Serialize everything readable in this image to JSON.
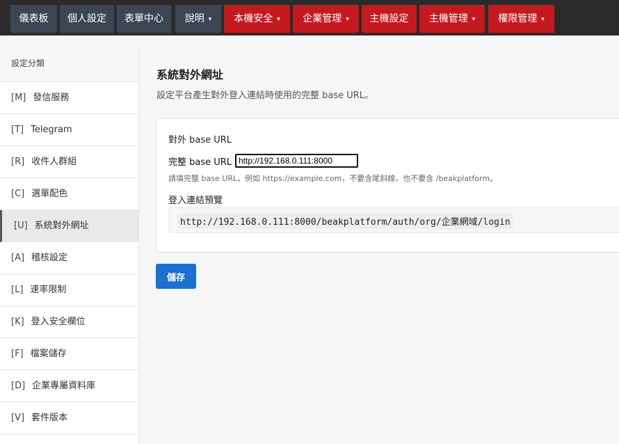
{
  "nav": {
    "items": [
      {
        "label": "儀表板",
        "style": "dark",
        "caret": ""
      },
      {
        "label": "個人設定",
        "style": "dark",
        "caret": ""
      },
      {
        "label": "表單中心",
        "style": "dark",
        "caret": ""
      },
      {
        "label": "說明",
        "style": "dark",
        "caret": "▾"
      },
      {
        "label": "本機安全",
        "style": "red",
        "caret": "▾"
      },
      {
        "label": "企業管理",
        "style": "red",
        "caret": "▾"
      },
      {
        "label": "主機設定",
        "style": "red",
        "caret": ""
      },
      {
        "label": "主機管理",
        "style": "red",
        "caret": "▾"
      },
      {
        "label": "權限管理",
        "style": "red",
        "caret": "▾"
      }
    ]
  },
  "sidebar": {
    "heading": "設定分類",
    "items": [
      {
        "code": "[M]",
        "label": "發信服務"
      },
      {
        "code": "[T]",
        "label": "Telegram"
      },
      {
        "code": "[R]",
        "label": "收件人群組"
      },
      {
        "code": "[C]",
        "label": "選單配色"
      },
      {
        "code": "[U]",
        "label": "系統對外網址"
      },
      {
        "code": "[A]",
        "label": "稽核設定"
      },
      {
        "code": "[L]",
        "label": "速率限制"
      },
      {
        "code": "[K]",
        "label": "登入安全欄位"
      },
      {
        "code": "[F]",
        "label": "檔案儲存"
      },
      {
        "code": "[D]",
        "label": "企業專屬資料庫"
      },
      {
        "code": "[V]",
        "label": "套件版本"
      }
    ],
    "active_index": 4
  },
  "main": {
    "title": "系統對外網址",
    "description": "設定平台產生對外登入連結時使用的完整 base URL。",
    "card": {
      "heading": "對外 base URL",
      "field_label": "完整 base URL",
      "field_value": "http://192.168.0.111:8000",
      "hint": "請填完整 base URL，例如 https://example.com，不要含尾斜線，也不要含 /beakplatform。",
      "preview_label": "登入連結預覽",
      "preview_url": "http://192.168.0.111:8000/beakplatform/auth/org/企業網域/login"
    },
    "save_label": "儲存"
  },
  "colors": {
    "nav_dark": "#3b4652",
    "nav_red": "#c41a1f",
    "primary": "#1a6fd0",
    "topbar_bg": "#2b2b2b"
  }
}
